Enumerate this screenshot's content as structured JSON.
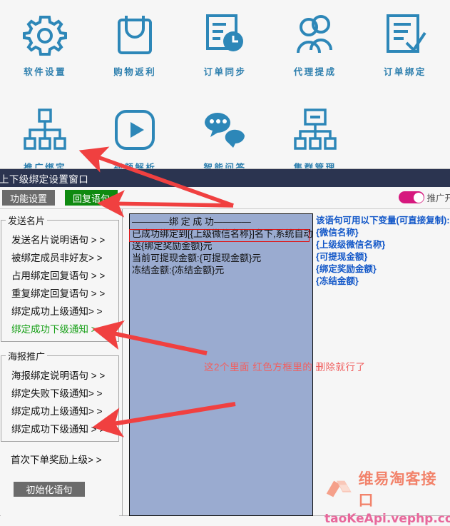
{
  "launcher": {
    "row1": [
      {
        "label": "软件设置",
        "icon": "gear-icon"
      },
      {
        "label": "购物返利",
        "icon": "shopping-bag-icon"
      },
      {
        "label": "订单同步",
        "icon": "order-clock-icon"
      },
      {
        "label": "代理提成",
        "icon": "users-icon"
      },
      {
        "label": "订单绑定",
        "icon": "document-check-icon"
      }
    ],
    "row2": [
      {
        "label": "推广绑定",
        "icon": "hierarchy-icon"
      },
      {
        "label": "视频解析",
        "icon": "play-icon"
      },
      {
        "label": "智能问答",
        "icon": "chat-bubbles-icon"
      },
      {
        "label": "集群管理",
        "icon": "cluster-icon"
      }
    ],
    "accent_color": "#2d7fae"
  },
  "window": {
    "title": "上下级绑定设置窗口",
    "titlebar_color": "#2b3450"
  },
  "tabs": [
    {
      "label": "功能设置",
      "state": "inactive",
      "color": "#6b6b6b"
    },
    {
      "label": "回复语句",
      "state": "active",
      "color": "#0f8a10"
    }
  ],
  "toggle": {
    "label": "推广开",
    "on": true,
    "color": "#d6187e"
  },
  "sidebar": {
    "groups": [
      {
        "title": "发送名片",
        "items": [
          {
            "label": "发送名片说明语句 > >",
            "active": false
          },
          {
            "label": "被绑定成员非好友> >",
            "active": false
          },
          {
            "label": "占用绑定回复语句 > >",
            "active": false
          },
          {
            "label": "重复绑定回复语句 > >",
            "active": false
          },
          {
            "label": "绑定成功上级通知> >",
            "active": false
          },
          {
            "label": "绑定成功下级通知 > >",
            "active": true
          }
        ]
      },
      {
        "title": "海报推广",
        "items": [
          {
            "label": "海报绑定说明语句 > >",
            "active": false
          },
          {
            "label": "绑定失败下级通知> >",
            "active": false
          },
          {
            "label": "绑定成功上级通知> >",
            "active": false
          },
          {
            "label": "绑定成功下级通知 > >",
            "active": false
          }
        ]
      }
    ],
    "standalone_item": "首次下单奖励上级> >",
    "init_button": "初始化语句"
  },
  "editor": {
    "bg_color": "#9aabd0",
    "lines": [
      "————绑 定 成 功————",
      "已成功绑定到[{上级微信名称}]名下,系统自动赠",
      "送{绑定奖励金额}元",
      "当前可提现金额:{可提现金额}元",
      "冻结金额:{冻结金额}元"
    ],
    "highlighted_line_index": 1,
    "highlight_color": "#e01414"
  },
  "variables": {
    "heading": "该语句可用以下变量(可直接复制):",
    "items": [
      "{微信名称}",
      "{上级级微信名称}",
      "{可提现金额}",
      "{绑定奖励金额}",
      "{冻结金额}"
    ],
    "color": "#1257c8"
  },
  "annotations": {
    "red_note": "这2个里面 红色方框里的 删除就行了",
    "arrow_color": "#f04040"
  },
  "watermark": {
    "brand": "维易淘客接口",
    "url": "taoKeApi.vephp.com",
    "brand_color": "#f2836b",
    "url_color": "#e8679b"
  }
}
